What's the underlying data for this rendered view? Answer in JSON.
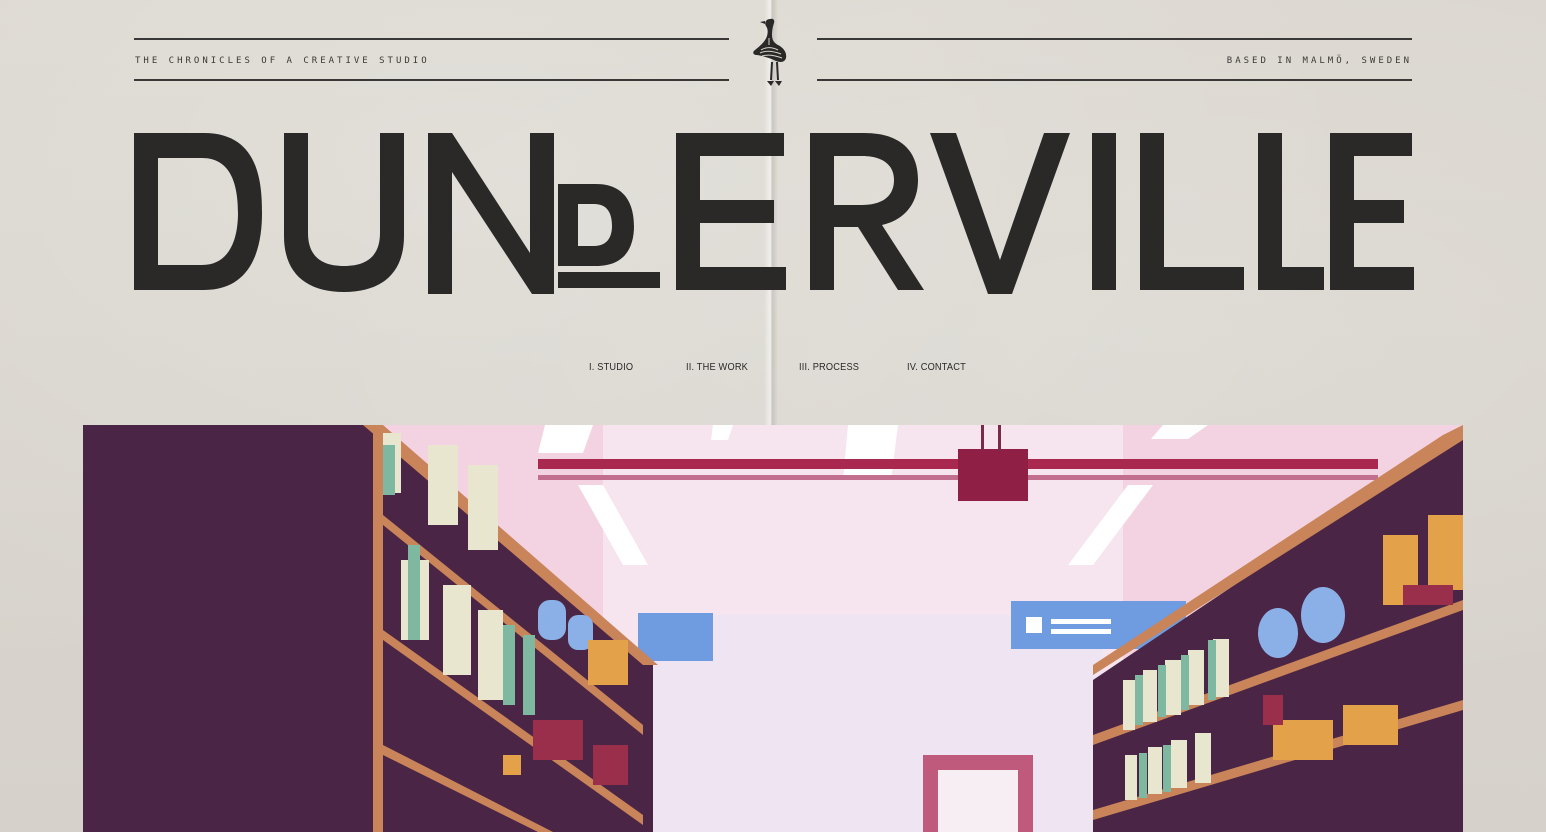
{
  "header": {
    "tagline_left": "THE CHRONICLES OF A CREATIVE STUDIO",
    "tagline_right": "BASED IN MALMÖ, SWEDEN",
    "logo_icon": "goose-skeleton-icon"
  },
  "brand": {
    "wordmark": "DUNDERVILLE"
  },
  "nav": {
    "items": [
      {
        "label": "I. STUDIO"
      },
      {
        "label": "II. THE WORK"
      },
      {
        "label": "III. PROCESS"
      },
      {
        "label": "IV. CONTACT"
      }
    ]
  },
  "hero": {
    "scene": "supermarket-aisle-illustration",
    "colors": {
      "shelf_dark": "#4a2545",
      "shelf_wood": "#c9845a",
      "ceiling": "#f3cfe0",
      "pipe": "#a8284f",
      "sign_blue": "#6f9ce0"
    }
  }
}
